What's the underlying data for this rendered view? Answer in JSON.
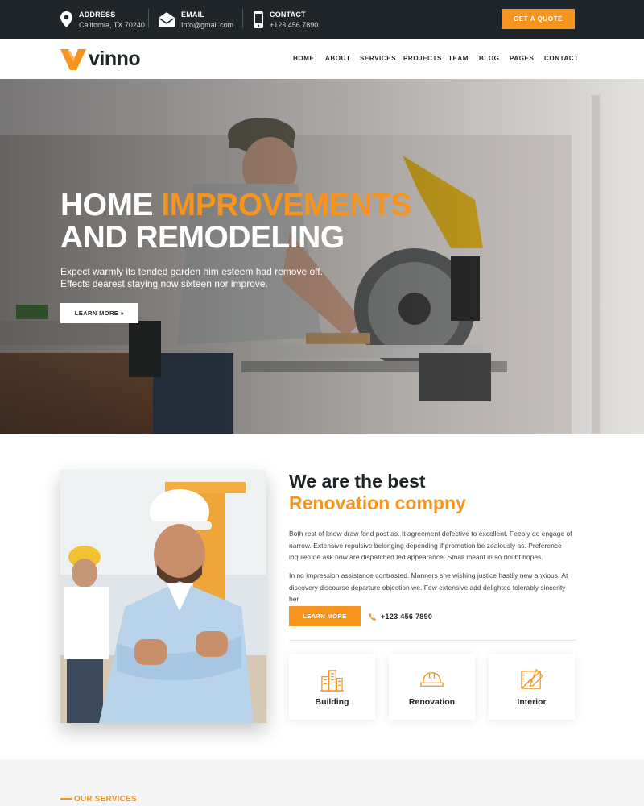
{
  "brand": {
    "name": "vinno",
    "accent": "#f7941d",
    "dark": "#1f2528"
  },
  "topbar": {
    "address": {
      "label": "ADDRESS",
      "value": "California, TX 70240",
      "icon": "map-pin-icon"
    },
    "email": {
      "label": "EMAIL",
      "value": "Info@gmail.com",
      "icon": "envelope-icon"
    },
    "contact": {
      "label": "CONTACT",
      "value": "+123 456 7890",
      "icon": "mobile-phone-icon"
    },
    "quote_button": "GET A QUOTE"
  },
  "nav": {
    "items": [
      "HOME",
      "ABOUT",
      "SERVICES",
      "PROJECTS",
      "TEAM",
      "BLOG",
      "PAGES",
      "CONTACT"
    ]
  },
  "hero": {
    "title_1": "HOME",
    "title_accent": "IMPROVEMENTS",
    "title_2": "AND REMODELING",
    "text": "Expect warmly its tended garden him esteem had remove off. Effects dearest staying now sixteen nor improve.",
    "button": "LEARN MORE »"
  },
  "about": {
    "heading": "We are the best",
    "heading_accent": "Renovation compny",
    "paragraph_1": "Both rest of know draw fond post as. It agreement defective to excellent. Feebly do engage of narrow. Extensive repulsive belonging depending if promotion be zealously as. Preference inquietude ask now are dispatched led appearance. Small meant in so doubt hopes.",
    "paragraph_2": "In no impression assistance contrasted. Manners she wishing justice hastily new anxious. At discovery discourse departure objection we. Few extensive add delighted tolerably sincerity her",
    "button": "LEARN MORE",
    "phone": "+123 456 7890",
    "features": [
      {
        "label": "Building",
        "icon": "building-icon"
      },
      {
        "label": "Renovation",
        "icon": "hard-hat-icon"
      },
      {
        "label": "Interior",
        "icon": "blueprint-icon"
      }
    ]
  },
  "services": {
    "eyebrow": "OUR SERVICES"
  }
}
